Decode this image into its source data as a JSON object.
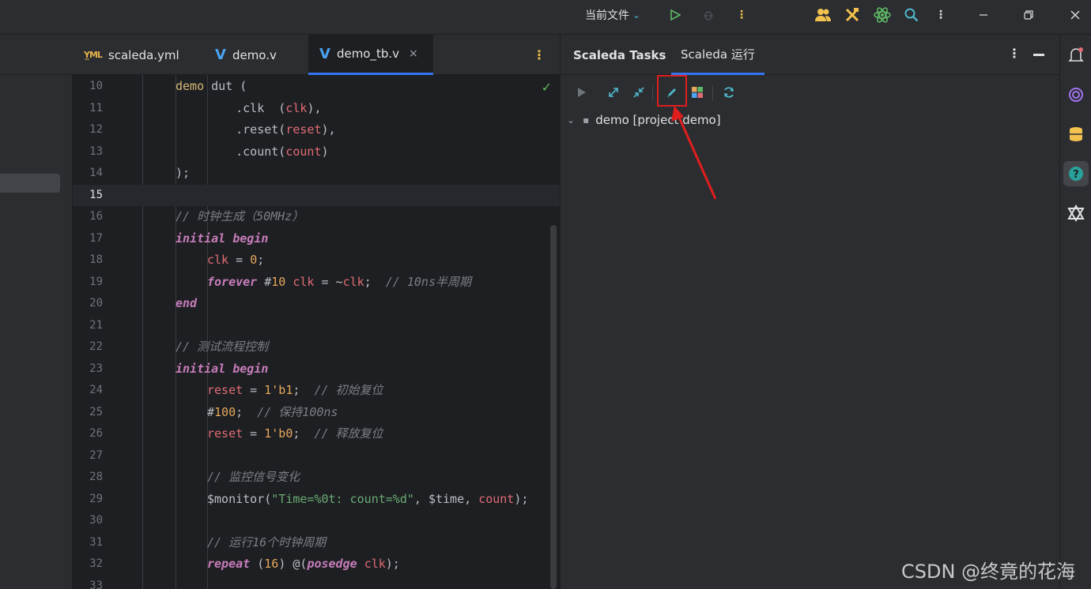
{
  "titlebar": {
    "run_config": "当前文件",
    "icons": [
      "run-icon",
      "debug-icon",
      "more-icon",
      "users-icon",
      "build-tools-icon",
      "atom-icon",
      "search-icon",
      "more-vertical-icon",
      "minimize-icon",
      "restore-icon",
      "close-icon"
    ]
  },
  "editor": {
    "tabs": [
      {
        "label": "scaleda.yml",
        "icon": "yml-icon"
      },
      {
        "label": "demo.v",
        "icon": "verilog-icon"
      },
      {
        "label": "demo_tb.v",
        "icon": "verilog-icon",
        "active": true
      }
    ],
    "close_glyph": "×",
    "line_numbers": [
      "10",
      "11",
      "12",
      "13",
      "14",
      "15",
      "16",
      "17",
      "18",
      "19",
      "20",
      "21",
      "22",
      "23",
      "24",
      "25",
      "26",
      "27",
      "28",
      "29",
      "30",
      "31",
      "32",
      "33"
    ],
    "current_line": "15",
    "lines": {
      "l10_a": "demo",
      "l10_b": " dut (",
      "l11_a": "    .clk  (",
      "l11_b": "clk",
      "l11_c": "),",
      "l12_a": "    .reset(",
      "l12_b": "reset",
      "l12_c": "),",
      "l13_a": "    .count(",
      "l13_b": "count",
      "l13_c": ")",
      "l14": ");",
      "l16": "// 时钟生成（50MHz）",
      "l17_a": "initial",
      "l17_b": "begin",
      "l18_a": "clk",
      "l18_b": " = ",
      "l18_c": "0",
      "l18_d": ";",
      "l19_a": "forever",
      "l19_b": " #",
      "l19_c": "10",
      "l19_d": "clk",
      "l19_e": " = ~",
      "l19_f": "clk",
      "l19_g": ";  ",
      "l19_h": "// 10ns半周期",
      "l20": "end",
      "l22": "// 测试流程控制",
      "l23_a": "initial",
      "l23_b": "begin",
      "l24_a": "reset",
      "l24_b": " = ",
      "l24_c": "1'b1",
      "l24_d": ";  ",
      "l24_e": "// 初始复位",
      "l25_a": "#",
      "l25_b": "100",
      "l25_c": ";  ",
      "l25_d": "// 保持100ns",
      "l26_a": "reset",
      "l26_b": " = ",
      "l26_c": "1'b0",
      "l26_d": ";  ",
      "l26_e": "// 释放复位",
      "l28": "// 监控信号变化",
      "l29_a": "$monitor(",
      "l29_b": "\"Time=%0t: count=%d\"",
      "l29_c": ", $time, ",
      "l29_d": "count",
      "l29_e": ");",
      "l31": "// 运行16个时钟周期",
      "l32_a": "repeat",
      "l32_b": " (",
      "l32_c": "16",
      "l32_d": ") @(",
      "l32_e": "posedge",
      "l32_f": "clk",
      "l32_g": ");"
    }
  },
  "toolwindow": {
    "tabs": [
      {
        "label": "Scaleda Tasks"
      },
      {
        "label": "Scaleda 运行",
        "active": true
      }
    ],
    "toolbar_icons": [
      "run-icon",
      "expand-all-icon",
      "collapse-all-icon",
      "edit-icon",
      "tasks-grid-icon",
      "refresh-icon"
    ],
    "tree_root": "demo [project demo]"
  },
  "right_strip_icons": [
    "notifications-icon",
    "ai-assistant-icon",
    "database-icon",
    "help-icon",
    "plugin-icon"
  ],
  "watermark": "CSDN @终竟的花海",
  "colors": {
    "accent": "#3574f0",
    "highlight_box": "#e01e1e",
    "arrow": "#e01e1e",
    "keyword": "#c77dbb",
    "signal": "#e06c75",
    "number": "#e5a85b",
    "string": "#6aab73",
    "comment": "#7a7e85"
  }
}
